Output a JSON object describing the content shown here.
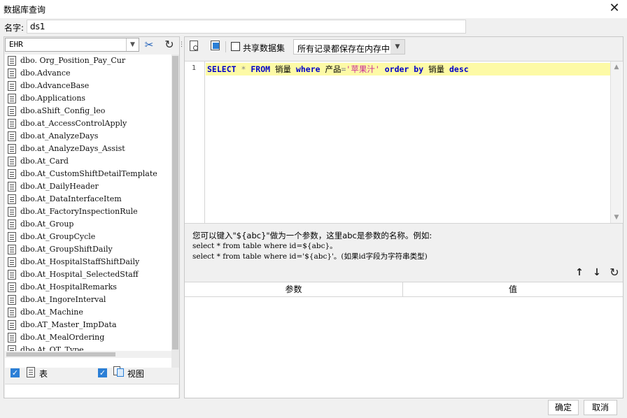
{
  "window": {
    "title": "数据库查询",
    "close_glyph": "✕"
  },
  "name_field": {
    "label": "名字:",
    "value": "ds1"
  },
  "left": {
    "database": "EHR",
    "tables": [
      "dbo. Org_Position_Pay_Cur",
      "dbo.Advance",
      "dbo.AdvanceBase",
      "dbo.Applications",
      "dbo.aShift_Config_leo",
      "dbo.at_AccessControlApply",
      "dbo.at_AnalyzeDays",
      "dbo.at_AnalyzeDays_Assist",
      "dbo.At_Card",
      "dbo.At_CustomShiftDetailTemplate",
      "dbo.At_DailyHeader",
      "dbo.At_DataInterfaceItem",
      "dbo.At_FactoryInspectionRule",
      "dbo.At_Group",
      "dbo.At_GroupCycle",
      "dbo.At_GroupShiftDaily",
      "dbo.At_HospitalStaffShiftDaily",
      "dbo.At_Hospital_SelectedStaff",
      "dbo.At_HospitalRemarks",
      "dbo.At_IngoreInterval",
      "dbo.At_Machine",
      "dbo.AT_Master_ImpData",
      "dbo.At_MealOrdering",
      "dbo.At_OT_Type"
    ],
    "filter": {
      "table_label": "表",
      "table_checked": true,
      "view_label": "视图",
      "view_checked": true
    }
  },
  "toolbar": {
    "share_label": "共享数据集",
    "share_checked": false,
    "memory_option": "所有记录都保存在内存中"
  },
  "editor": {
    "line_number": "1",
    "tokens": [
      {
        "t": "SELECT",
        "k": "kw"
      },
      {
        "t": " ",
        "k": "id"
      },
      {
        "t": "*",
        "k": "op"
      },
      {
        "t": " ",
        "k": "id"
      },
      {
        "t": "FROM",
        "k": "kw"
      },
      {
        "t": " 销量 ",
        "k": "id"
      },
      {
        "t": "where",
        "k": "kw"
      },
      {
        "t": " 产品",
        "k": "id"
      },
      {
        "t": "=",
        "k": "op"
      },
      {
        "t": "'苹果汁'",
        "k": "str"
      },
      {
        "t": " ",
        "k": "id"
      },
      {
        "t": "order",
        "k": "kw"
      },
      {
        "t": " ",
        "k": "id"
      },
      {
        "t": "by",
        "k": "kw"
      },
      {
        "t": " 销量 ",
        "k": "id"
      },
      {
        "t": "desc",
        "k": "kw"
      }
    ]
  },
  "hint": {
    "line1": "您可以键入\"${abc}\"做为一个参数，这里abc是参数的名称。例如:",
    "line2": "select * from table where id=${abc}。",
    "line3": "select * from table where id='${abc}'。(如果id字段为字符串类型)"
  },
  "params": {
    "col_param": "参数",
    "col_value": "值"
  },
  "buttons": {
    "ok": "确定",
    "cancel": "取消"
  }
}
